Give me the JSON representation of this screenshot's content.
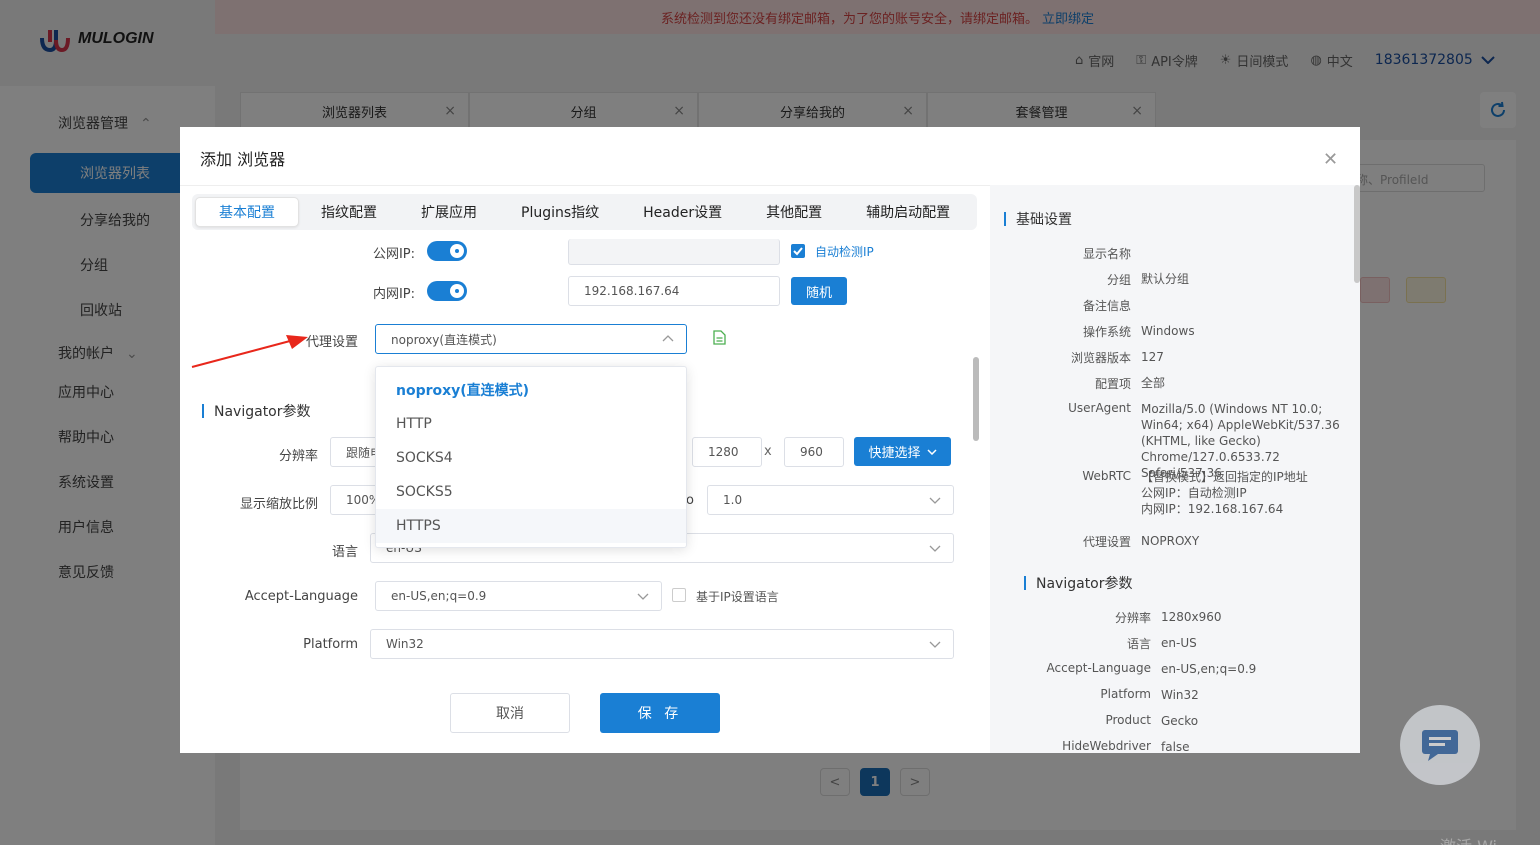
{
  "app": {
    "logo_text": "MULOGIN"
  },
  "banner": {
    "text": "系统检测到您还没有绑定邮箱，为了您的账号安全，请绑定邮箱。",
    "link": "立即绑定"
  },
  "topnav": {
    "official": "官网",
    "api": "API令牌",
    "theme": "日间模式",
    "lang": "中文",
    "user": "18361372805"
  },
  "sidebar": {
    "browser_mgmt": "浏览器管理",
    "items": [
      "浏览器列表",
      "分享给我的",
      "分组",
      "回收站"
    ],
    "my_account": "我的帐户",
    "others": [
      "应用中心",
      "帮助中心",
      "系统设置",
      "用户信息",
      "意见反馈"
    ]
  },
  "bg_tabs": [
    "浏览器列表",
    "分组",
    "分享给我的",
    "套餐管理"
  ],
  "bg_search_placeholder": "称、ProfileId",
  "pager": {
    "prev": "<",
    "current": "1",
    "next": ">"
  },
  "modal": {
    "title": "添加 浏览器",
    "tabs": [
      "基本配置",
      "指纹配置",
      "扩展应用",
      "Plugins指纹",
      "Header设置",
      "其他配置",
      "辅助启动配置"
    ],
    "public_ip_label": "公网IP:",
    "auto_detect_label": "自动检测IP",
    "private_ip_label": "内网IP:",
    "private_ip_value": "192.168.167.64",
    "random_btn": "随机",
    "proxy_label": "代理设置",
    "proxy_value": "noproxy(直连模式)",
    "proxy_options": [
      "noproxy(直连模式)",
      "HTTP",
      "SOCKS4",
      "SOCKS5",
      "HTTPS"
    ],
    "navigator_title": "Navigator参数",
    "resolution_label": "分辨率",
    "resolution_mode": "跟随电",
    "res_w": "1280",
    "res_x": "x",
    "res_h": "960",
    "quick_select": "快捷选择",
    "scale_label": "显示缩放比例",
    "scale_value": "100%",
    "dpr_tail": "o",
    "dpr_value": "1.0",
    "lang_label": "语言",
    "lang_value": "en-US",
    "accept_lang_label": "Accept-Language",
    "accept_lang_value": "en-US,en;q=0.9",
    "ip_lang_label": "基于IP设置语言",
    "platform_label": "Platform",
    "platform_value": "Win32",
    "cancel": "取消",
    "save": "保 存"
  },
  "summary": {
    "basic_title": "基础设置",
    "rows": [
      {
        "k": "显示名称",
        "v": ""
      },
      {
        "k": "分组",
        "v": "默认分组"
      },
      {
        "k": "备注信息",
        "v": ""
      },
      {
        "k": "操作系统",
        "v": "Windows"
      },
      {
        "k": "浏览器版本",
        "v": "127"
      },
      {
        "k": "配置项",
        "v": "全部"
      },
      {
        "k": "UserAgent",
        "v": "Mozilla/5.0 (Windows NT 10.0; Win64; x64) AppleWebKit/537.36 (KHTML, like Gecko) Chrome/127.0.6533.72 Safari/537.36"
      },
      {
        "k": "WebRTC",
        "v": "【替换模式】返回指定的IP地址"
      },
      {
        "k": "",
        "v": "公网IP：自动检测IP"
      },
      {
        "k": "",
        "v": "内网IP：192.168.167.64"
      },
      {
        "k": "代理设置",
        "v": "NOPROXY"
      }
    ],
    "nav_title": "Navigator参数",
    "nav_rows": [
      {
        "k": "分辨率",
        "v": "1280x960"
      },
      {
        "k": "语言",
        "v": "en-US"
      },
      {
        "k": "Accept-Language",
        "v": "en-US,en;q=0.9"
      },
      {
        "k": "Platform",
        "v": "Win32"
      },
      {
        "k": "Product",
        "v": "Gecko"
      },
      {
        "k": "HideWebdriver",
        "v": "false"
      }
    ]
  },
  "colors": {
    "accent": "#1a7fd4",
    "banner_bg": "#fde2e2",
    "banner_text": "#d64545",
    "arrow": "#e8271b"
  },
  "watermark": "激活 Wi"
}
